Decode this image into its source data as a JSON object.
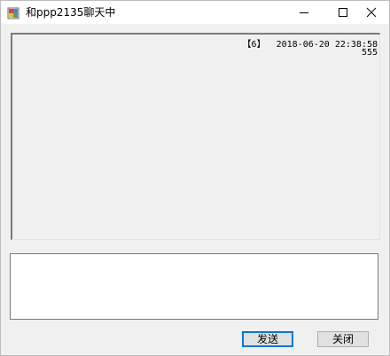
{
  "window": {
    "title": "和ppp2135聊天中",
    "controls": {
      "minimize_icon": "minimize-icon",
      "maximize_icon": "maximize-icon",
      "close_icon": "close-icon"
    }
  },
  "chat": {
    "messages": [
      {
        "header": "【6】  2018-06-20 22:38:58",
        "body": "555"
      }
    ],
    "compose_value": ""
  },
  "buttons": {
    "send_label": "发送",
    "close_label": "关闭"
  },
  "colors": {
    "focus_border": "#0078d7",
    "background": "#f0f0f0"
  }
}
